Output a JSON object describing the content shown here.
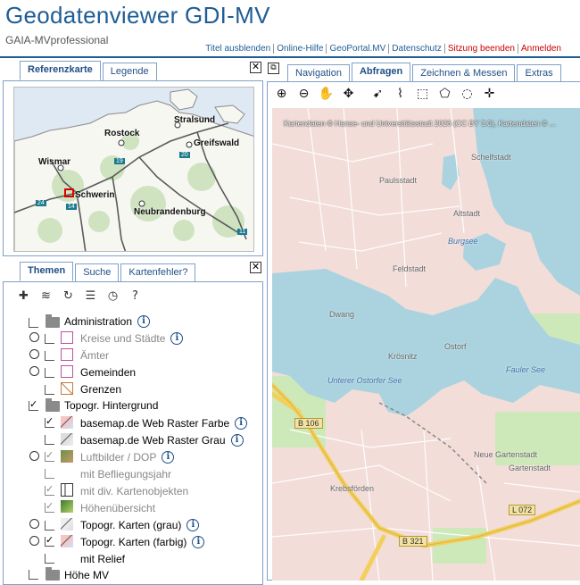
{
  "header": {
    "title": "Geodatenviewer GDI-MV",
    "subtitle": "GAIA-MVprofessional",
    "links": [
      {
        "label": "Titel ausblenden",
        "red": false
      },
      {
        "label": "Online-Hilfe",
        "red": false
      },
      {
        "label": "GeoPortal.MV",
        "red": false
      },
      {
        "label": "Datenschutz",
        "red": false
      },
      {
        "label": "Sitzung beenden",
        "red": true
      },
      {
        "label": "Anmelden",
        "red": true
      }
    ]
  },
  "left_top": {
    "tabs": [
      "Referenzkarte",
      "Legende"
    ],
    "active_tab": "Referenzkarte",
    "overview_labels": [
      "Stralsund",
      "Rostock",
      "Greifswald",
      "Wismar",
      "Schwerin",
      "Neubrandenburg"
    ],
    "overview_shields": [
      "20",
      "19",
      "24",
      "14",
      "11"
    ]
  },
  "left_bottom": {
    "tabs": [
      "Themen",
      "Suche",
      "Kartenfehler?"
    ],
    "active_tab": "Themen",
    "tree": [
      {
        "label": "Administration",
        "info": "i"
      },
      {
        "label": "Kreise und Städte",
        "info": "i"
      },
      {
        "label": "Ämter"
      },
      {
        "label": "Gemeinden"
      },
      {
        "label": "Grenzen"
      },
      {
        "label": "Topogr. Hintergrund"
      },
      {
        "label": "basemap.de Web Raster Farbe",
        "info": "i"
      },
      {
        "label": "basemap.de Web Raster Grau",
        "info": "i"
      },
      {
        "label": "Luftbilder / DOP",
        "info": "i"
      },
      {
        "label": "mit Befliegungsjahr"
      },
      {
        "label": "mit div. Kartenobjekten"
      },
      {
        "label": "Höhenübersicht"
      },
      {
        "label": "Topogr. Karten (grau)",
        "info": "i"
      },
      {
        "label": "Topogr. Karten (farbig)",
        "info": "i"
      },
      {
        "label": "mit Relief"
      },
      {
        "label": "Höhe MV"
      }
    ]
  },
  "right": {
    "tabs": [
      "Navigation",
      "Abfragen",
      "Zeichnen & Messen",
      "Extras"
    ],
    "active_tab": "Abfragen",
    "credit": "Kartendaten © Hanse- und Universitätsstadt 2026 (CC BY 3.0), Kartendaten © ...",
    "map_labels": {
      "schelfstadt": "Schelfstadt",
      "paulsstadt": "Paulsstadt",
      "altstadt": "Altstadt",
      "burgsee": "Burgsee",
      "feldstadt": "Feldstadt",
      "dwang": "Dwang",
      "ostorf": "Ostorf",
      "krosnitz": "Krösnitz",
      "unterer_ostorfer_see": "Unterer Ostorfer See",
      "fauler_see": "Fauler See",
      "neue_gartenstadt": "Neue Gartenstadt",
      "gartenstadt": "Gartenstadt",
      "krebsfoerden": "Krebsförden"
    },
    "road_shields": {
      "b106": "B 106",
      "b321": "B 321",
      "l072": "L 072"
    }
  },
  "colors": {
    "brand": "#1f5d96",
    "tab_border": "#7fa0c8",
    "water": "#aad3df",
    "urban": "#f0d8d6",
    "road_major": "#f7d66b",
    "link_red": "#cc0000"
  }
}
